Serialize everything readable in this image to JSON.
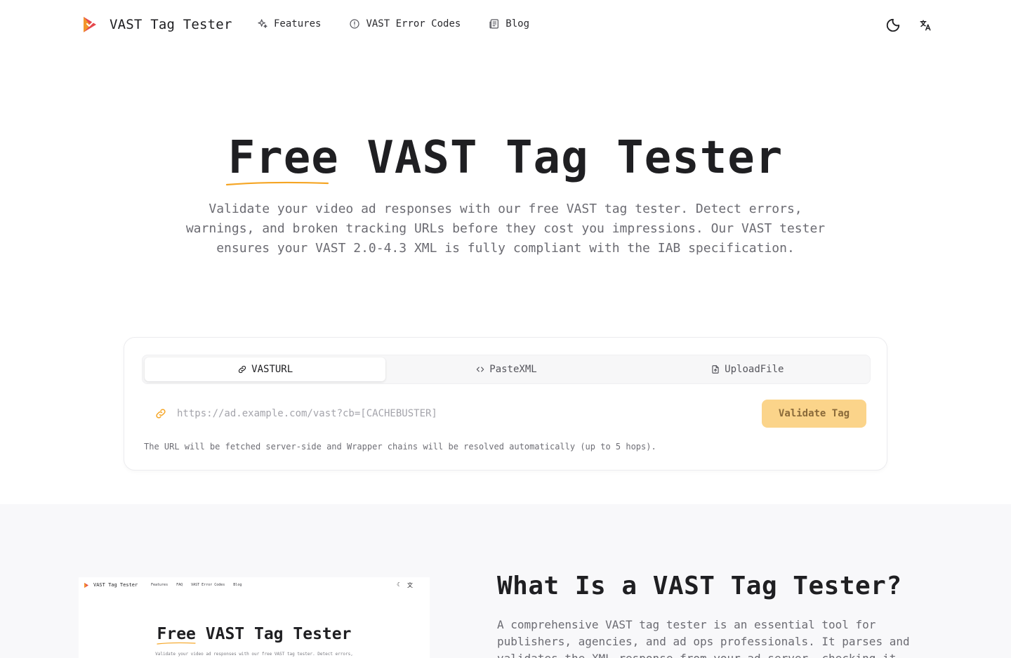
{
  "nav": {
    "brand": "VAST Tag Tester",
    "links": [
      {
        "label": "Features",
        "icon": "sparkles-icon"
      },
      {
        "label": "VAST Error Codes",
        "icon": "alert-circle-icon"
      },
      {
        "label": "Blog",
        "icon": "newspaper-icon"
      }
    ],
    "theme_icon": "moon-icon",
    "language_icon": "translate-icon"
  },
  "hero": {
    "title_highlight": "Free",
    "title_rest": " VAST Tag Tester",
    "subtitle": "Validate your video ad responses with our free VAST tag tester. Detect errors, warnings, and broken tracking URLs before they cost you impressions. Our VAST tester ensures your VAST 2.0-4.3 XML is fully compliant with the IAB specification."
  },
  "tester": {
    "tabs": [
      {
        "label": "VASTURL",
        "icon": "link-icon",
        "active": true
      },
      {
        "label": "PasteXML",
        "icon": "code-icon",
        "active": false
      },
      {
        "label": "UploadFile",
        "icon": "file-upload-icon",
        "active": false
      }
    ],
    "url_value": "",
    "url_placeholder": "https://ad.example.com/vast?cb=[CACHEBUSTER]",
    "validate_label": "Validate Tag",
    "helper_text": "The URL will be fetched server-side and Wrapper chains will be resolved automatically (up to 5 hops)."
  },
  "about": {
    "preview": {
      "brand": "VAST Tag Tester",
      "links": [
        "Features",
        "FAQ",
        "VAST Error Codes",
        "Blog"
      ],
      "title_highlight": "Free",
      "title_rest": " VAST Tag Tester",
      "subtitle": "Validate your video ad responses with our free VAST tag tester. Detect errors,"
    },
    "title": "What Is a VAST Tag Tester?",
    "body": "A comprehensive VAST tag tester is an essential tool for publishers, agencies, and ad ops professionals. It parses and validates the XML response from your ad server, checking it"
  },
  "colors": {
    "accent": "#f5a524",
    "button_bg": "#fbd48a",
    "button_text": "#8a6a3a",
    "logo_red": "#e5484d",
    "section_bg": "#f8f8fa"
  }
}
